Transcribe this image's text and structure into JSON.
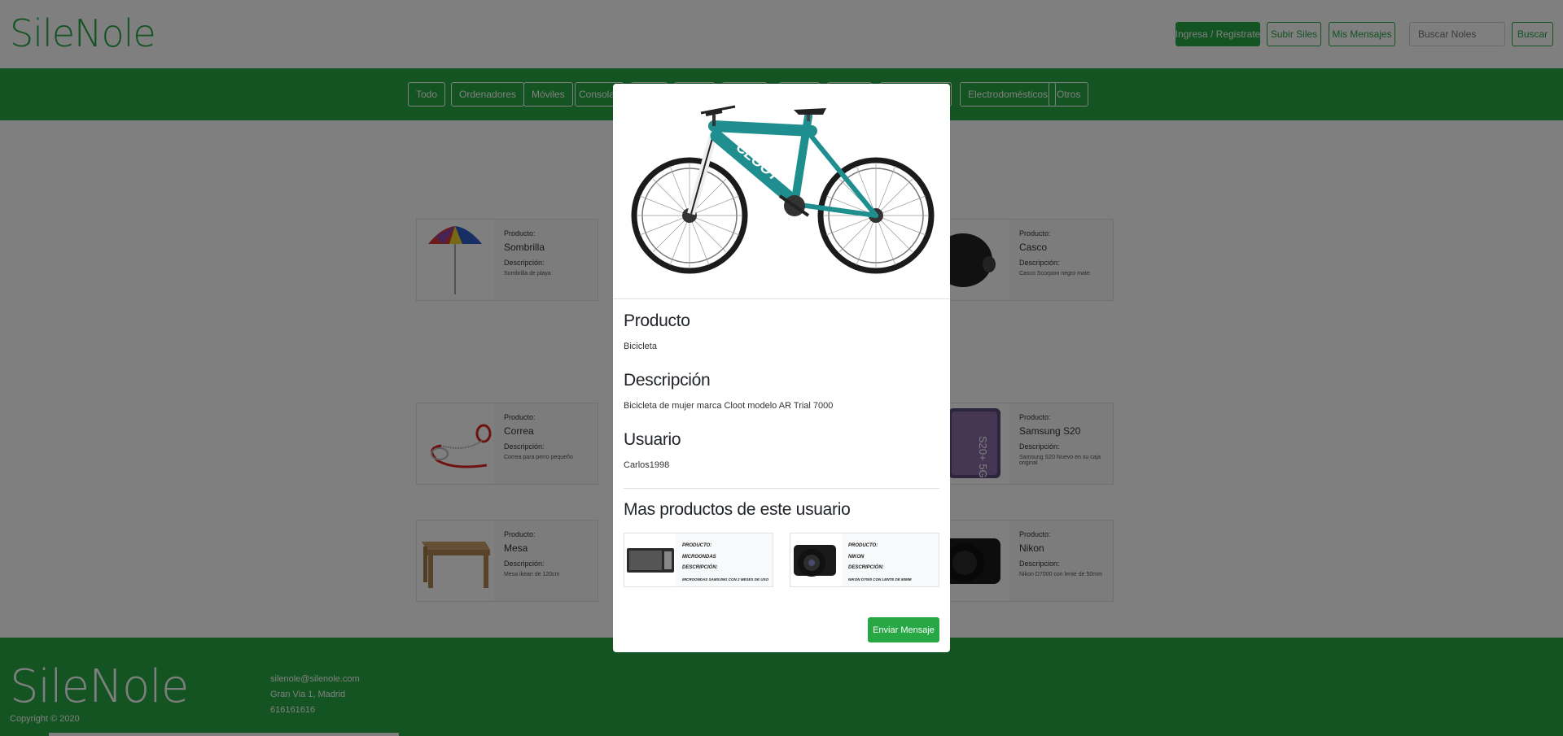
{
  "header": {
    "brand": "SileNole",
    "login_label": "Ingresa / Registrate",
    "upload_label": "Subir Siles",
    "messages_label": "Mis Mensajes",
    "search_placeholder": "Buscar Noles",
    "search_button": "Buscar"
  },
  "categories": [
    "Todo",
    "Ordenadores",
    "Móviles",
    "Consolas",
    "",
    "",
    "",
    "",
    "",
    "",
    "Electrodomésticos",
    "Otros"
  ],
  "cards": [
    {
      "label_product": "Producto:",
      "name": "Sombrilla",
      "label_desc": "Descripción:",
      "desc": "Sombrilla de playa",
      "image": "umbrella"
    },
    {
      "label_product": "Producto:",
      "name": "Casco",
      "label_desc": "Descripción:",
      "desc": "Casco Scorpion negro mate",
      "image": "helmet"
    },
    {
      "label_product": "Producto:",
      "name": "Correa",
      "label_desc": "Descripción:",
      "desc": "Correa para perro pequeño",
      "image": "leash"
    },
    {
      "label_product": "Producto:",
      "name": "Samsung S20",
      "label_desc": "Descripción:",
      "desc": "Samsung S20 Nuevo en su caja original",
      "image": "phone"
    },
    {
      "label_product": "Producto:",
      "name": "Mesa",
      "label_desc": "Descripción:",
      "desc": "Mesa ikean de 120cm",
      "image": "table"
    },
    {
      "label_product": "Producto:",
      "name": "Nikon",
      "label_desc": "Descripcion:",
      "desc": "Nikon D7000 con lente de 50mm",
      "image": "camera"
    }
  ],
  "modal": {
    "product_heading": "Producto",
    "product_value": "Bicicleta",
    "desc_heading": "Descripción",
    "desc_value": "Bicicleta de mujer marca Cloot modelo AR Trial 7000",
    "user_heading": "Usuario",
    "user_value": "Carlos1998",
    "more_heading": "Mas productos de este usuario",
    "more": [
      {
        "label_product": "Producto:",
        "name": "Microondas",
        "label_desc": "Descripción:",
        "desc": "Microondas Samsung con 2 meses de uso"
      },
      {
        "label_product": "Producto:",
        "name": "Nikon",
        "label_desc": "Descripción:",
        "desc": "Nikon D7000 con lente de 50mm"
      }
    ],
    "send_label": "Enviar Mensaje"
  },
  "footer": {
    "brand": "SileNole",
    "copyright": "Copyright © 2020",
    "email": "silenole@silenole.com",
    "address": "Gran Via 1, Madrid",
    "phone": "616161616"
  },
  "colors": {
    "accent": "#28a745",
    "overlay": "rgba(0,0,0,0.5)",
    "bike_frame": "#1f8e8f"
  }
}
